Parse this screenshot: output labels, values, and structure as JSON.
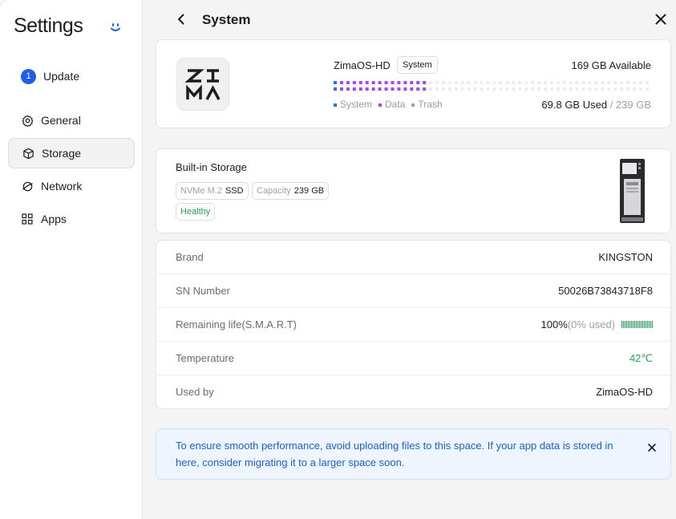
{
  "sidebar": {
    "title": "Settings",
    "update": {
      "badge": "1",
      "label": "Update"
    },
    "items": [
      {
        "label": "General",
        "icon": "gear-icon"
      },
      {
        "label": "Storage",
        "icon": "box-icon",
        "active": true
      },
      {
        "label": "Network",
        "icon": "globe-icon"
      },
      {
        "label": "Apps",
        "icon": "apps-grid-icon"
      }
    ]
  },
  "header": {
    "title": "System"
  },
  "system_card": {
    "os_name": "ZimaOS-HD",
    "os_tag": "System",
    "available": "169 GB Available",
    "used": "69.8 GB Used",
    "total": "/ 239 GB",
    "used_fraction": 0.292,
    "legend": [
      {
        "label": "System",
        "color": "#2f6fe8"
      },
      {
        "label": "Data",
        "color": "#a64ae6"
      },
      {
        "label": "Trash",
        "color": "#a0a0a6"
      }
    ]
  },
  "builtin_card": {
    "title": "Built-in Storage",
    "interface_label": "NVMe M.2",
    "interface_value": "SSD",
    "capacity_label": "Capacity",
    "capacity_value": "239 GB",
    "health": "Healthy"
  },
  "details": {
    "brand_label": "Brand",
    "brand_value": "KINGSTON",
    "sn_label": "SN Number",
    "sn_value": "50026B73843718F8",
    "life_label": "Remaining life(S.M.A.R.T)",
    "life_pct": "100%",
    "life_used": "(0% used)",
    "life_fraction": 1.0,
    "temp_label": "Temperature",
    "temp_value": "42℃",
    "usedby_label": "Used by",
    "usedby_value": "ZimaOS-HD"
  },
  "notice": {
    "text": "To ensure smooth performance, avoid uploading files to this space. If your app data is stored in here, consider migrating it to a larger space soon."
  },
  "colors": {
    "accent": "#1e5eea",
    "system": "#2f6fe8",
    "data": "#a64ae6",
    "healthy": "#22a454",
    "notice_text": "#1d5fd0"
  }
}
